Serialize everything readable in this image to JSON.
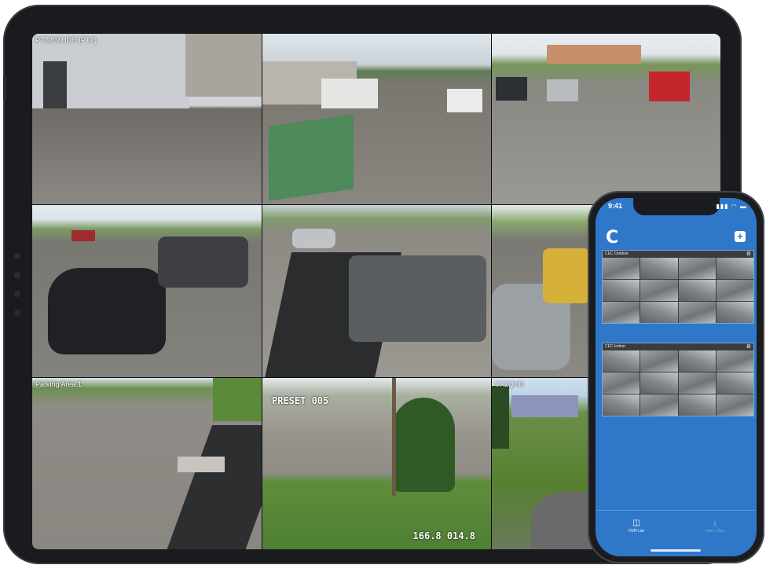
{
  "tablet": {
    "cameras": [
      {
        "label": "PTZ20XHDR (PTZ)",
        "osd": ""
      },
      {
        "label": "",
        "osd": ""
      },
      {
        "label": "",
        "osd": ""
      },
      {
        "label": "",
        "osd": ""
      },
      {
        "label": "",
        "osd": ""
      },
      {
        "label": "",
        "osd": ""
      },
      {
        "label": "Parking Area 1",
        "osd": ""
      },
      {
        "label": "",
        "osd_top": "PRESET 005",
        "osd_bottom": "166.8 014.8"
      },
      {
        "label": "VX2QHD",
        "osd": ""
      }
    ]
  },
  "phone": {
    "status_time": "9:41",
    "status_icons": "▮▮▮ ◠ ▬",
    "app_logo": "C",
    "add_label": "+",
    "dvrs": [
      {
        "name": "CEC Outdoor",
        "thumb_count": 16
      },
      {
        "name": "CEC Indoor",
        "thumb_count": 16
      }
    ],
    "tabs": [
      {
        "label": "DVR List",
        "icon": "camera-icon"
      },
      {
        "label": "Video Clips",
        "icon": "download-icon"
      }
    ]
  }
}
